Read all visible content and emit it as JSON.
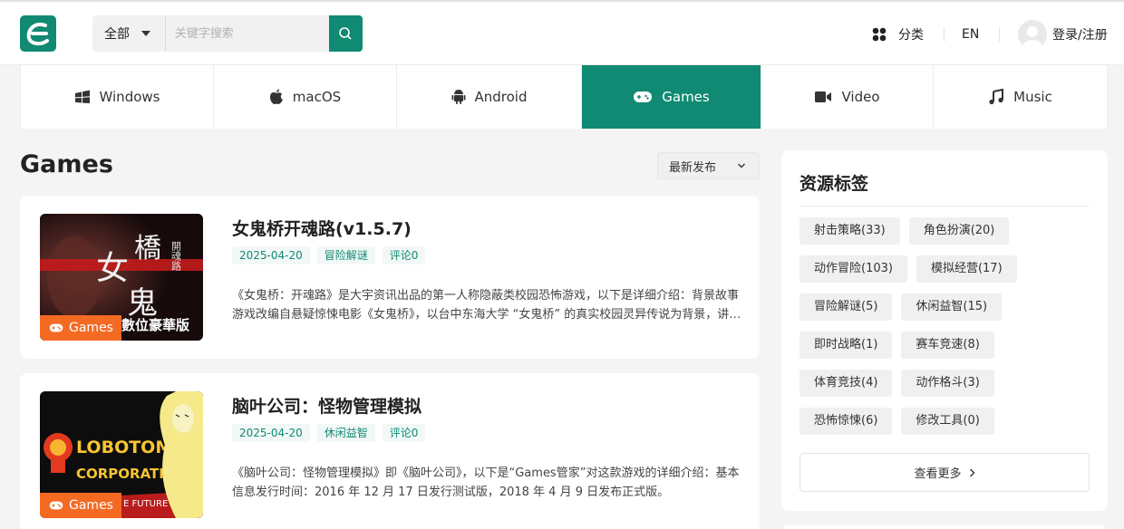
{
  "header": {
    "search": {
      "category": "全部",
      "placeholder": "关键字搜索"
    },
    "nav_category_label": "分类",
    "lang_label": "EN",
    "login_label": "登录/注册"
  },
  "tabs": [
    {
      "label": "Windows",
      "icon": "windows-icon"
    },
    {
      "label": "macOS",
      "icon": "apple-icon"
    },
    {
      "label": "Android",
      "icon": "android-icon"
    },
    {
      "label": "Games",
      "icon": "gamepad-icon",
      "active": true
    },
    {
      "label": "Video",
      "icon": "video-camera-icon"
    },
    {
      "label": "Music",
      "icon": "music-note-icon"
    }
  ],
  "main": {
    "title": "Games",
    "sort_label": "最新发布",
    "posts": [
      {
        "title": "女鬼桥开魂路(v1.5.7)",
        "date": "2025-04-20",
        "tag": "冒险解谜",
        "comments": "评论0",
        "badge": "Games",
        "thumb_lines": [
          "女",
          "鬼",
          "橋",
          "開魂路",
          "數位豪華版"
        ],
        "desc": "《女鬼桥：开魂路》是大宇资讯出品的第一人称隐蔽类校园恐怖游戏，以下是详细介绍：背景故事游戏改编自悬疑惊悚电影《女鬼桥》，以台中东海大学 “女鬼桥” 的真实校园灵异传说为背景，讲述一群学生意外卷入灵异事件的故事。"
      },
      {
        "title": "脑叶公司：怪物管理模拟",
        "date": "2025-04-20",
        "tag": "休闲益智",
        "comments": "评论0",
        "badge": "Games",
        "thumb_lines": [
          "LOBOTOMY",
          "CORPORATION",
          "E FUTURE"
        ],
        "desc": "《脑叶公司：怪物管理模拟》即《脑叶公司》，以下是“Games管家”对这款游戏的详细介绍：基本信息发行时间：2016 年 12 月 17 日发行测试版，2018 年 4 月 9 日发布正式版。"
      }
    ]
  },
  "sidebar": {
    "title": "资源标签",
    "tag_rows": [
      [
        "射击策略(33)",
        "角色扮演(20)"
      ],
      [
        "动作冒险(103)",
        "模拟经营(17)"
      ],
      [
        "冒险解谜(5)",
        "休闲益智(15)"
      ],
      [
        "即时战略(1)",
        "赛车竞速(8)"
      ],
      [
        "体育竞技(4)",
        "动作格斗(3)"
      ],
      [
        "恐怖惊悚(6)",
        "修改工具(0)"
      ]
    ],
    "more_label": "查看更多"
  },
  "colors": {
    "brand": "#108a72",
    "badge": "#f46a23"
  }
}
